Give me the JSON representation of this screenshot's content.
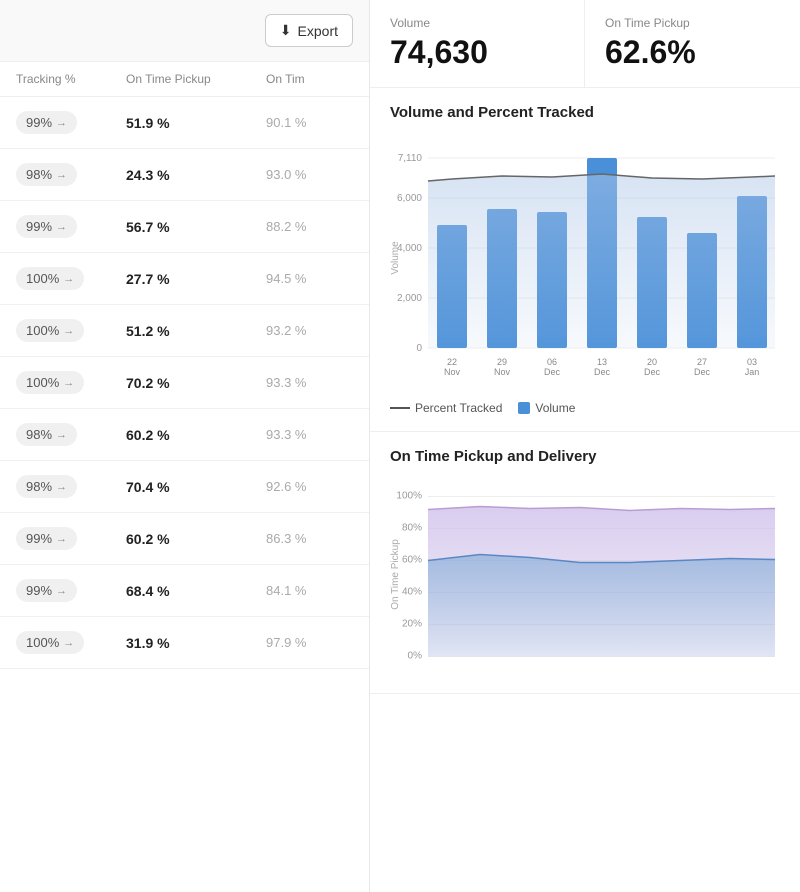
{
  "export_button": "Export",
  "columns": {
    "tracking": "Tracking %",
    "on_time_pickup": "On Time Pickup",
    "on_time_delivery": "On Tim"
  },
  "rows": [
    {
      "tracking": "99%",
      "on_time_pickup": "51.9 %",
      "on_time_delivery": "90.1 %"
    },
    {
      "tracking": "98%",
      "on_time_pickup": "24.3 %",
      "on_time_delivery": "93.0 %"
    },
    {
      "tracking": "99%",
      "on_time_pickup": "56.7 %",
      "on_time_delivery": "88.2 %"
    },
    {
      "tracking": "100%",
      "on_time_pickup": "27.7 %",
      "on_time_delivery": "94.5 %"
    },
    {
      "tracking": "100%",
      "on_time_pickup": "51.2 %",
      "on_time_delivery": "93.2 %"
    },
    {
      "tracking": "100%",
      "on_time_pickup": "70.2 %",
      "on_time_delivery": "93.3 %"
    },
    {
      "tracking": "98%",
      "on_time_pickup": "60.2 %",
      "on_time_delivery": "93.3 %"
    },
    {
      "tracking": "98%",
      "on_time_pickup": "70.4 %",
      "on_time_delivery": "92.6 %"
    },
    {
      "tracking": "99%",
      "on_time_pickup": "60.2 %",
      "on_time_delivery": "86.3 %"
    },
    {
      "tracking": "99%",
      "on_time_pickup": "68.4 %",
      "on_time_delivery": "84.1 %"
    },
    {
      "tracking": "100%",
      "on_time_pickup": "31.9 %",
      "on_time_delivery": "97.9 %"
    }
  ],
  "metrics": {
    "volume_label": "Volume",
    "volume_value": "74,630",
    "pickup_label": "On Time Pickup",
    "pickup_value": "62.6%"
  },
  "volume_chart": {
    "title": "Volume and Percent Tracked",
    "y_max": "7,110",
    "y_labels": [
      "7,110",
      "6,000",
      "4,000",
      "2,000",
      "0"
    ],
    "x_labels": [
      "22\nNov",
      "29\nNov",
      "06\nDec",
      "13\nDec",
      "20\nDec",
      "27\nDec",
      "03\nJan"
    ],
    "bars": [
      4600,
      5200,
      5100,
      7110,
      4900,
      4300,
      5700
    ],
    "y_axis_label": "Volume",
    "legend": {
      "line": "Percent Tracked",
      "bar": "Volume"
    }
  },
  "pickup_chart": {
    "title": "On Time Pickup and Delivery",
    "y_labels": [
      "100%",
      "80%",
      "60%",
      "40%",
      "20%",
      "0%"
    ],
    "y_axis_label": "On Time Pickup"
  }
}
